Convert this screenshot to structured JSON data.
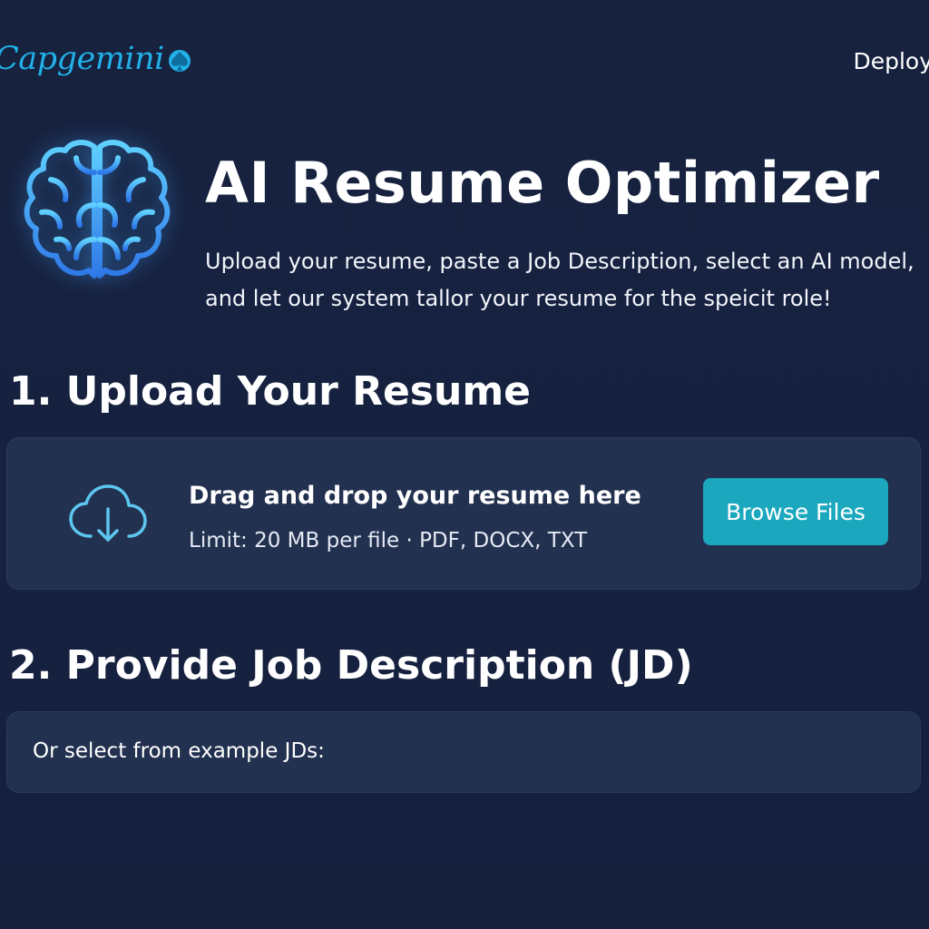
{
  "header": {
    "logo_text": "Capgemini",
    "deploy_label": "Deploy"
  },
  "hero": {
    "title": "AI Resume Optimizer",
    "subtitle": "Upload your resume, paste a Job Description, select an AI model, and let our system tallor your resume for the speicit role!",
    "icon": "brain-icon"
  },
  "upload_section": {
    "title": "1. Upload Your Resume",
    "drop_text": "Drag and drop your resume here",
    "limit_text": "Limit: 20 MB per file · PDF, DOCX, TXT",
    "browse_label": "Browse Files",
    "icon": "cloud-download-icon"
  },
  "jd_section": {
    "title": "2. Provide Job Description (JD)",
    "example_label": "Or select from example JDs:"
  },
  "colors": {
    "background": "#16213f",
    "card": "#233150",
    "accent": "#1ba8be",
    "brand": "#21b0e8",
    "icon_glow": "#46aaff"
  }
}
